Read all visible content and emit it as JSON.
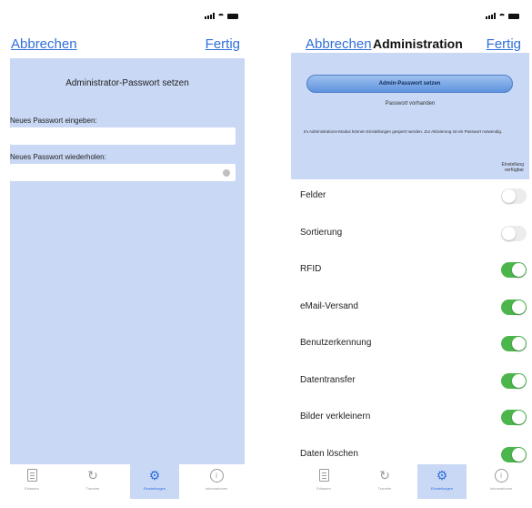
{
  "left": {
    "nav": {
      "cancel": "Abbrechen",
      "done": "Fertig"
    },
    "panel": {
      "title": "Administrator-Passwort setzen",
      "new_password_label": "Neues Passwort eingeben:",
      "new_password_value": "",
      "repeat_password_label": "Neues Passwort wiederholen:",
      "repeat_password_value": ""
    }
  },
  "right": {
    "nav": {
      "cancel": "Abbrechen",
      "title": "Administration",
      "done": "Fertig"
    },
    "admin": {
      "set_password_button": "Admin-Passwort setzen",
      "password_status": "Passwort vorhanden",
      "info_text": "Im Administrations-Modus können Einstellungen gesperrt werden. Zur Aktivierung ist ein Passwort notwendig.",
      "column_header": "Einstellung verfügbar"
    },
    "settings": [
      {
        "label": "Felder",
        "enabled": false
      },
      {
        "label": "Sortierung",
        "enabled": false
      },
      {
        "label": "RFID",
        "enabled": true
      },
      {
        "label": "eMail-Versand",
        "enabled": true
      },
      {
        "label": "Benutzerkennung",
        "enabled": true
      },
      {
        "label": "Datentransfer",
        "enabled": true
      },
      {
        "label": "Bilder verkleinern",
        "enabled": true
      },
      {
        "label": "Daten löschen",
        "enabled": true
      }
    ]
  },
  "tabbar": {
    "items": [
      {
        "label": "Erfassen",
        "icon": "clipboard-icon"
      },
      {
        "label": "Transfer",
        "icon": "sync-icon"
      },
      {
        "label": "Einstellungen",
        "icon": "gear-icon",
        "active": true
      },
      {
        "label": "Informationen",
        "icon": "info-icon"
      }
    ]
  },
  "colors": {
    "accent": "#2f6fd8",
    "panel": "#c9d8f5",
    "toggle_on": "#4cb64c",
    "toggle_off": "#ececec"
  }
}
